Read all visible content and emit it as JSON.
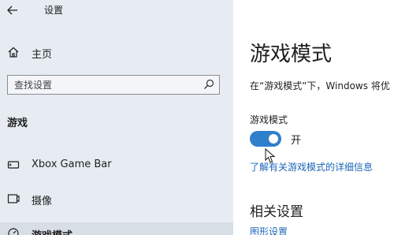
{
  "app": {
    "title": "设置",
    "back_icon": "back-arrow-icon"
  },
  "sidebar": {
    "home": {
      "label": "主页",
      "icon": "home-icon"
    },
    "search": {
      "placeholder": "查找设置",
      "value": "",
      "icon": "search-icon"
    },
    "section_heading": "游戏",
    "items": [
      {
        "label": "Xbox Game Bar",
        "icon": "game-bar-icon",
        "selected": false
      },
      {
        "label": "摄像",
        "icon": "capture-icon",
        "selected": false
      },
      {
        "label": "游戏模式",
        "icon": "game-mode-icon",
        "selected": true
      }
    ]
  },
  "main": {
    "title": "游戏模式",
    "description": "在“游戏模式”下，Windows 将优",
    "toggle": {
      "label": "游戏模式",
      "state_text": "开",
      "on": true
    },
    "learn_more_link": "了解有关游戏模式的详细信息",
    "related_heading": "相关设置",
    "graphics_link": "图形设置"
  },
  "colors": {
    "sidebar_bg": "#e6ecf2",
    "accent": "#2f7fcc",
    "link": "#1a66b8"
  }
}
